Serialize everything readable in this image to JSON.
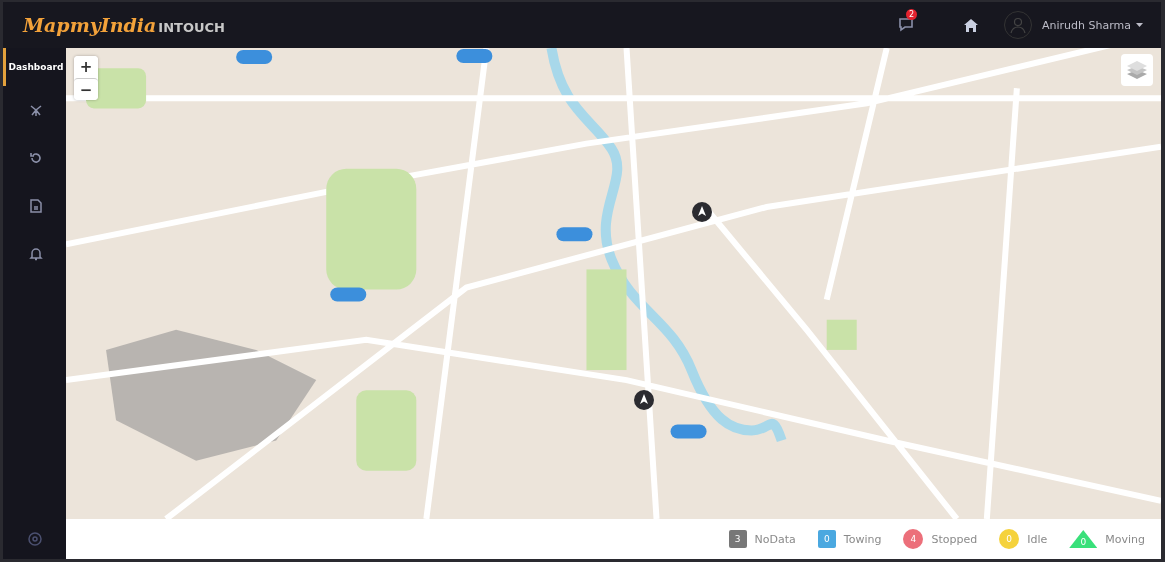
{
  "header": {
    "logo_brand": "MapmyIndia",
    "logo_product": "INTOUCH",
    "notifications": {
      "count": "2"
    },
    "user": {
      "name": "Anirudh Sharma"
    }
  },
  "sidebar": {
    "items": [
      {
        "kind": "text",
        "label": "Dashboard",
        "selected": true
      },
      {
        "kind": "tower",
        "selected": false
      },
      {
        "kind": "history",
        "selected": false
      },
      {
        "kind": "report",
        "selected": false
      },
      {
        "kind": "bell",
        "selected": false
      }
    ]
  },
  "map": {
    "zoom_in": "+",
    "zoom_out": "−"
  },
  "legend": [
    {
      "kind": "square",
      "color": "#777777",
      "count": "3",
      "label": "NoData"
    },
    {
      "kind": "square",
      "color": "#4aa8e0",
      "count": "0",
      "label": "Towing"
    },
    {
      "kind": "circle",
      "color": "#ec6f7a",
      "count": "4",
      "label": "Stopped"
    },
    {
      "kind": "circle",
      "color": "#f5d23c",
      "count": "0",
      "label": "Idle"
    },
    {
      "kind": "triangle",
      "color": "#39e07a",
      "count": "0",
      "label": "Moving"
    }
  ]
}
